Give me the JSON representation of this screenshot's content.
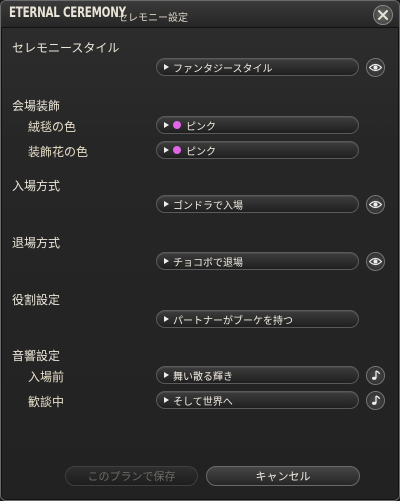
{
  "window": {
    "title_main": "ETERNAL CEREMONY",
    "title_sub": "セレモニー設定"
  },
  "sections": {
    "ceremony_style": {
      "title": "セレモニースタイル",
      "value": "ファンタジースタイル"
    },
    "venue": {
      "title": "会場装飾",
      "carpet_label": "絨毯の色",
      "carpet_value": "ピンク",
      "flower_label": "装飾花の色",
      "flower_value": "ピンク",
      "color_swatch": "#e066e6"
    },
    "entrance": {
      "title": "入場方式",
      "value": "ゴンドラで入場"
    },
    "exit": {
      "title": "退場方式",
      "value": "チョコボで退場"
    },
    "roles": {
      "title": "役割設定",
      "value": "パートナーがブーケを持つ"
    },
    "sound": {
      "title": "音響設定",
      "before_label": "入場前",
      "before_value": "舞い散る輝き",
      "chat_label": "歓談中",
      "chat_value": "そして世界へ"
    }
  },
  "footer": {
    "save_label": "このプランで保存",
    "cancel_label": "キャンセル"
  },
  "icons": {
    "preview": "eye-icon",
    "music": "music-note-icon",
    "close": "close-icon"
  }
}
